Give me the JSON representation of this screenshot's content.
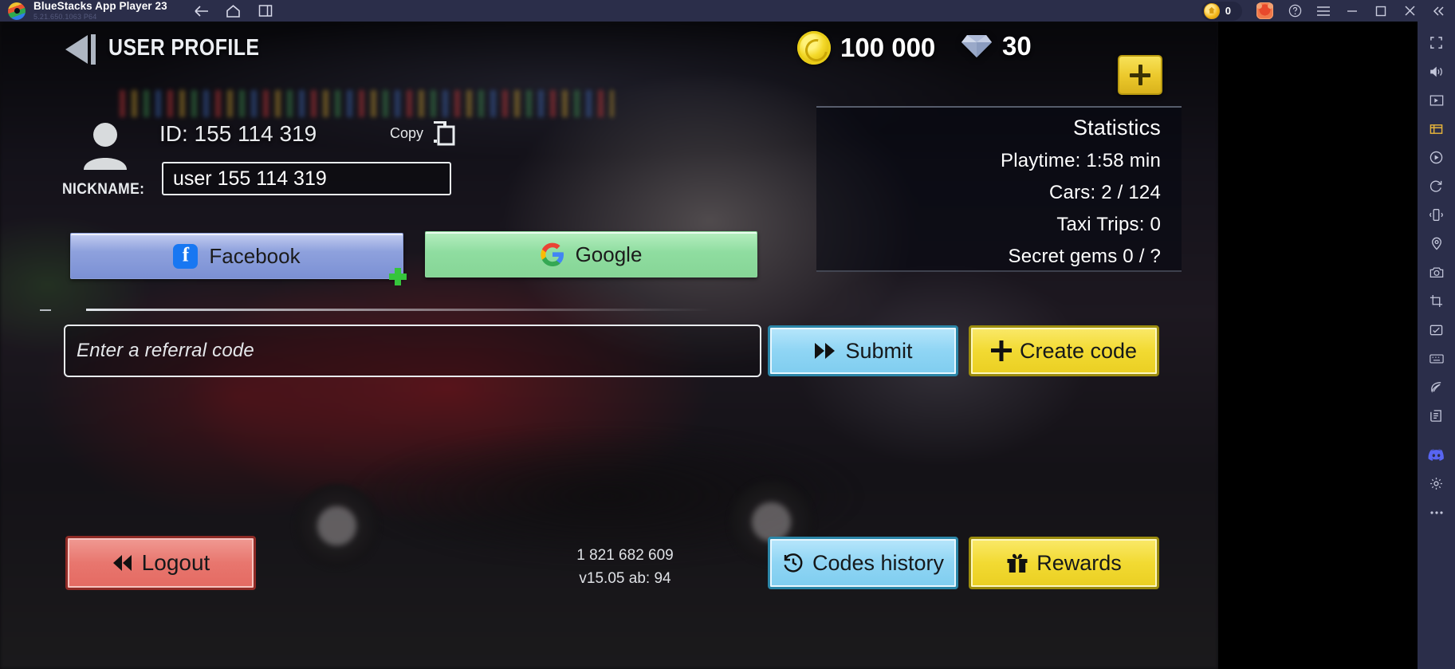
{
  "titlebar": {
    "app_name": "BlueStacks App Player 23",
    "version": "5.21.650.1063  P64",
    "coin_count": "0",
    "nav": [
      {
        "name": "back-arrow-icon",
        "label": "Back"
      },
      {
        "name": "home-icon",
        "label": "Home"
      },
      {
        "name": "multi-instance-icon",
        "label": "Multi-instance"
      }
    ],
    "right_icons": [
      {
        "name": "help-icon",
        "label": "Help"
      },
      {
        "name": "menu-icon",
        "label": "Menu"
      },
      {
        "name": "minimize-icon",
        "label": "Minimize"
      },
      {
        "name": "maximize-icon",
        "label": "Maximize"
      },
      {
        "name": "close-icon",
        "label": "Close"
      },
      {
        "name": "collapse-icon",
        "label": "Collapse"
      }
    ]
  },
  "game": {
    "header": {
      "title": "USER PROFILE",
      "coins": "100 000",
      "gems": "30",
      "add_button": "+"
    },
    "profile": {
      "id_label": "ID: 155 114 319",
      "nickname_label": "NICKNAME:",
      "nickname_value": "user 155 114 319",
      "copy_label": "Copy"
    },
    "social": {
      "facebook": "Facebook",
      "google": "Google"
    },
    "referral": {
      "placeholder": "Enter a referral code",
      "submit": "Submit",
      "create": "Create code"
    },
    "statistics": {
      "title": "Statistics",
      "rows": [
        "Playtime: 1:58 min",
        "Cars: 2 / 124",
        "Taxi Trips: 0",
        "Secret gems 0 / ?"
      ]
    },
    "footer": {
      "logout": "Logout",
      "codes_history": "Codes history",
      "rewards": "Rewards",
      "build_number": "1 821 682 609",
      "version": "v15.05 ab: 94"
    }
  },
  "sidebar": {
    "items": [
      {
        "name": "fullscreen-icon",
        "label": "Fullscreen"
      },
      {
        "name": "volume-icon",
        "label": "Volume"
      },
      {
        "name": "screenshot-icon",
        "label": "Screenshot"
      },
      {
        "name": "media-manager-icon",
        "label": "Media manager"
      },
      {
        "name": "record-icon",
        "label": "Record"
      },
      {
        "name": "rotate-icon",
        "label": "Rotate"
      },
      {
        "name": "shake-icon",
        "label": "Shake"
      },
      {
        "name": "location-icon",
        "label": "Location"
      },
      {
        "name": "camera-icon",
        "label": "Camera"
      },
      {
        "name": "crop-icon",
        "label": "Crop"
      },
      {
        "name": "macro-icon",
        "label": "Macro"
      },
      {
        "name": "keymap-icon",
        "label": "Keymapping"
      },
      {
        "name": "eco-mode-icon",
        "label": "Eco mode"
      },
      {
        "name": "script-icon",
        "label": "Script"
      },
      {
        "name": "discord-icon",
        "label": "Discord"
      },
      {
        "name": "settings-icon",
        "label": "Settings"
      },
      {
        "name": "more-icon",
        "label": "More"
      }
    ]
  },
  "colors": {
    "titlebar_bg": "#2b2e4a",
    "accent_yellow": "#f2da32",
    "accent_blue": "#8fd5f4",
    "accent_red": "#e8766e",
    "accent_green": "#8fdda0",
    "facebook_blue": "#1877f2"
  }
}
